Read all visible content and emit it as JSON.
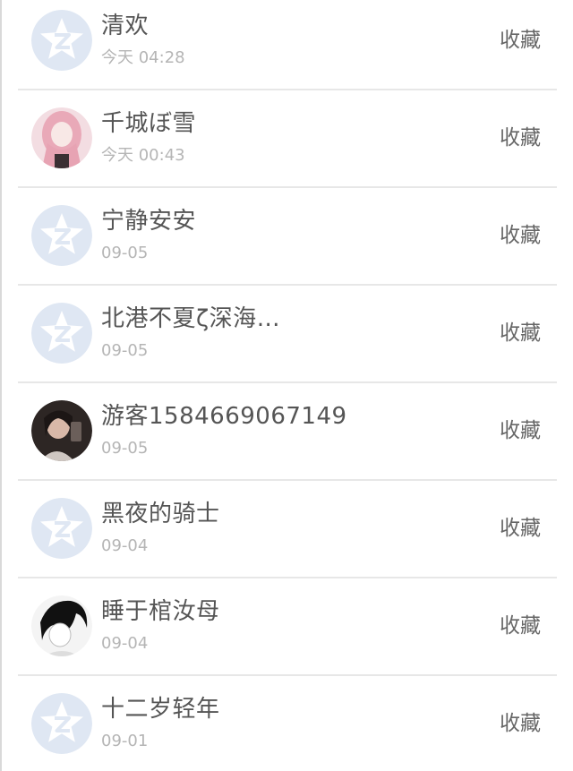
{
  "contacts": [
    {
      "name": "清欢",
      "time": "今天 04:28",
      "action": "收藏",
      "avatar": "qzone-default-icon"
    },
    {
      "name": "千城ぼ雪",
      "time": "今天 00:43",
      "action": "收藏",
      "avatar": "photo-pink-hair"
    },
    {
      "name": "宁静安安",
      "time": "09-05",
      "action": "收藏",
      "avatar": "qzone-default-icon"
    },
    {
      "name": "北港不夏ζ深海…",
      "time": "09-05",
      "action": "收藏",
      "avatar": "qzone-default-icon"
    },
    {
      "name": "游客1584669067149",
      "time": "09-05",
      "action": "收藏",
      "avatar": "photo-girl"
    },
    {
      "name": "黑夜的骑士",
      "time": "09-04",
      "action": "收藏",
      "avatar": "qzone-default-icon"
    },
    {
      "name": "睡于棺汝母",
      "time": "09-04",
      "action": "收藏",
      "avatar": "photo-sketch"
    },
    {
      "name": "十二岁轻年",
      "time": "09-01",
      "action": "收藏",
      "avatar": "qzone-default-icon"
    }
  ],
  "colors": {
    "default_avatar_bg": "#dfe7f3",
    "default_avatar_star": "#ffffff",
    "name_text": "#555555",
    "time_text": "#b5b5b5",
    "divider": "#e7e7e7"
  }
}
